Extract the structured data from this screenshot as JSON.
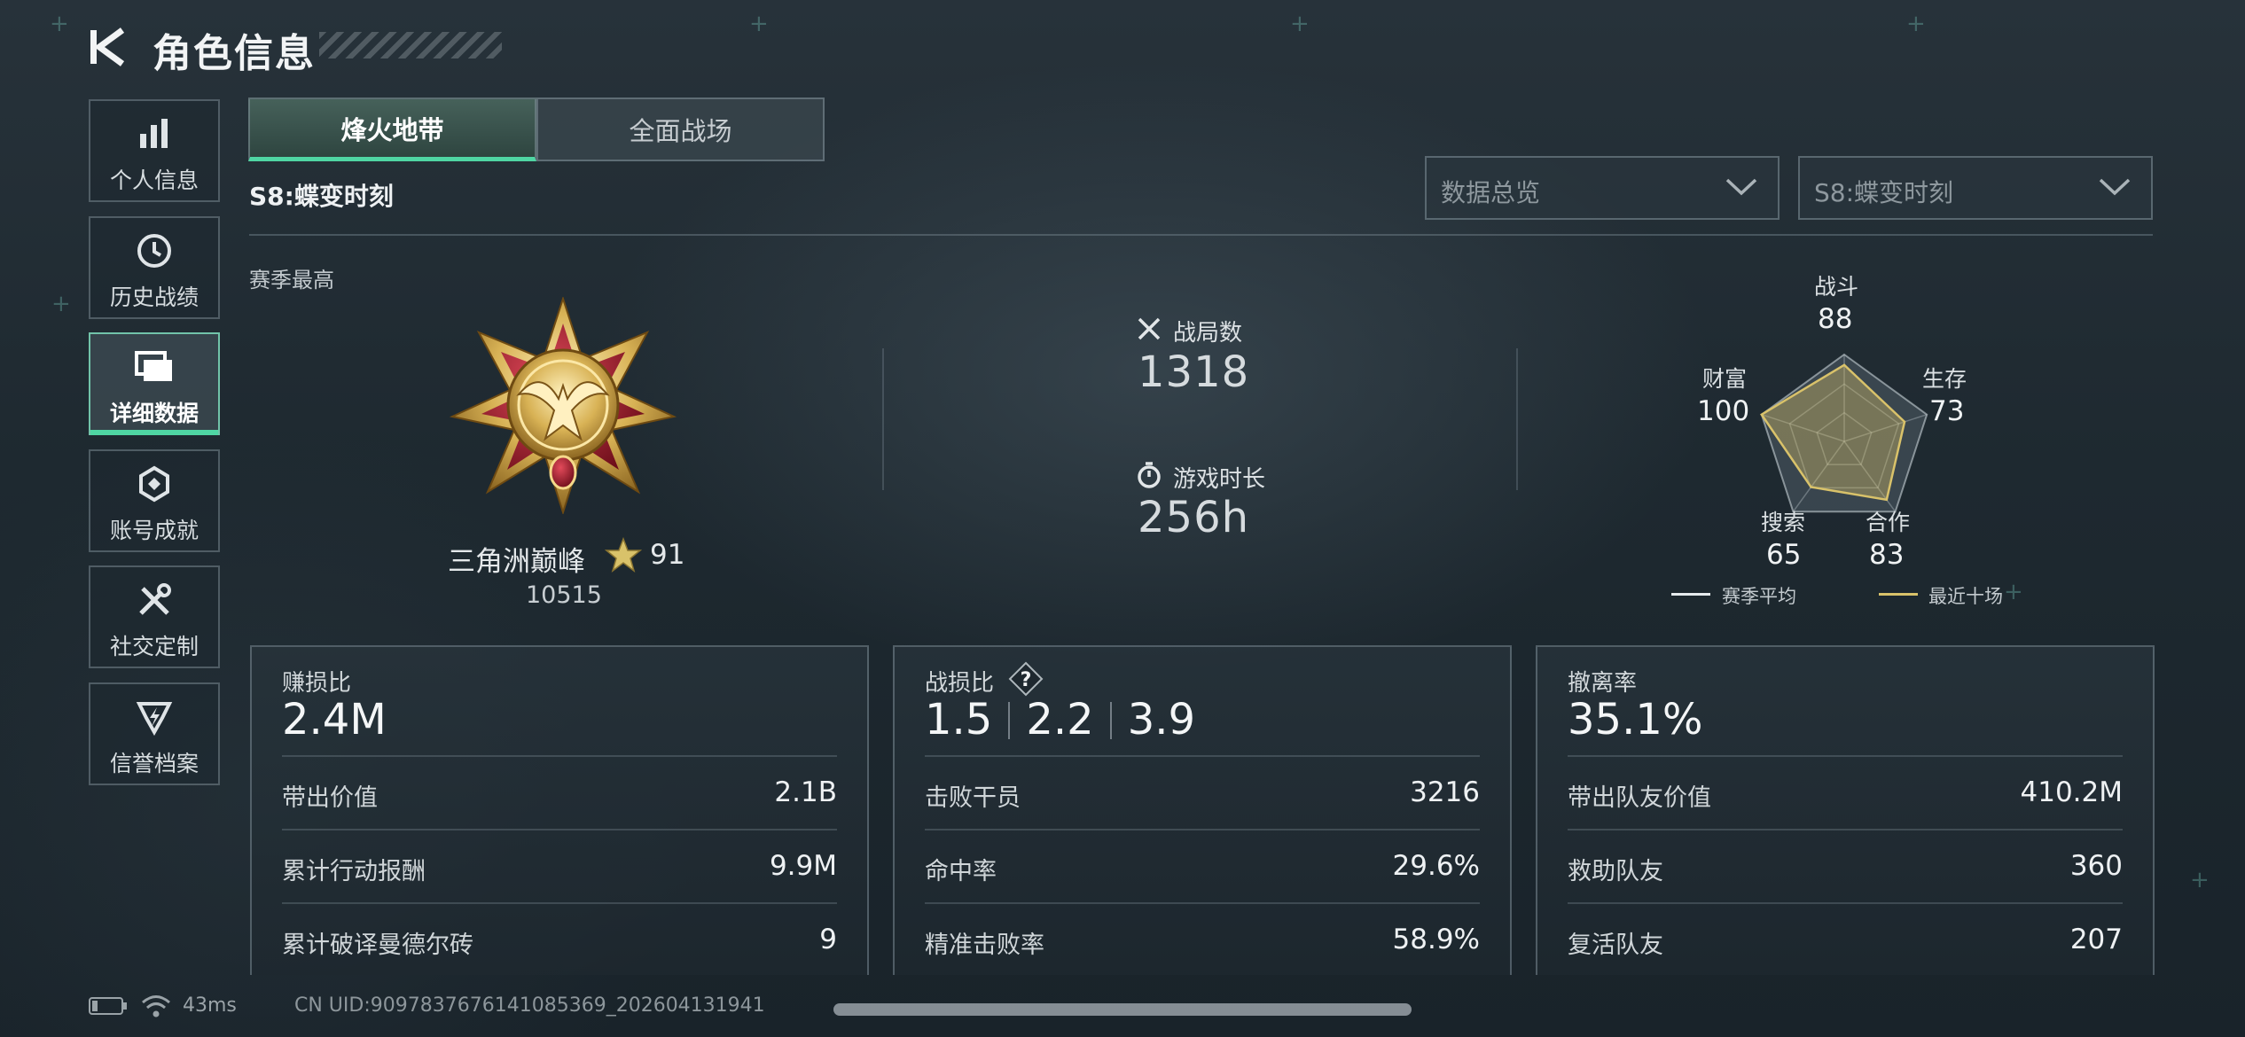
{
  "header": {
    "title": "角色信息"
  },
  "nav": {
    "items": [
      {
        "label": "个人信息",
        "icon": "bar-chart-icon"
      },
      {
        "label": "历史战绩",
        "icon": "clock-history-icon"
      },
      {
        "label": "详细数据",
        "icon": "cards-icon",
        "active": true
      },
      {
        "label": "账号成就",
        "icon": "achievement-icon"
      },
      {
        "label": "社交定制",
        "icon": "tools-icon"
      },
      {
        "label": "信誉档案",
        "icon": "shield-badge-icon"
      }
    ]
  },
  "tabs": [
    {
      "label": "烽火地带",
      "active": true
    },
    {
      "label": "全面战场",
      "active": false
    }
  ],
  "season": {
    "label": "S8:蝶变时刻"
  },
  "filters": {
    "data_type": "数据总览",
    "season": "S8:蝶变时刻"
  },
  "overview": {
    "season_best_label": "赛季最高",
    "rank_name": "三角洲巅峰",
    "rank_level": "91",
    "rank_score": "10515",
    "matches_label": "战局数",
    "matches_value": "1318",
    "playtime_label": "游戏时长",
    "playtime_value": "256h"
  },
  "radar": {
    "axes": [
      {
        "label": "战斗",
        "value": "88"
      },
      {
        "label": "生存",
        "value": "73"
      },
      {
        "label": "合作",
        "value": "83"
      },
      {
        "label": "搜索",
        "value": "65"
      },
      {
        "label": "财富",
        "value": "100"
      }
    ],
    "legend": {
      "season_avg": "赛季平均",
      "recent_ten": "最近十场"
    },
    "colors": {
      "season_avg": "#e6ebee",
      "recent_ten": "#d9c26a"
    }
  },
  "cards": {
    "profit": {
      "title": "赚损比",
      "big": "2.4M",
      "rows": [
        {
          "k": "带出价值",
          "v": "2.1B"
        },
        {
          "k": "累计行动报酬",
          "v": "9.9M"
        },
        {
          "k": "累计破译曼德尔砖",
          "v": "9"
        }
      ]
    },
    "kd": {
      "title": "战损比",
      "help": "?",
      "big": [
        "1.5",
        "2.2",
        "3.9"
      ],
      "rows": [
        {
          "k": "击败干员",
          "v": "3216"
        },
        {
          "k": "命中率",
          "v": "29.6%"
        },
        {
          "k": "精准击败率",
          "v": "58.9%"
        }
      ]
    },
    "extract": {
      "title": "撤离率",
      "big": "35.1%",
      "rows": [
        {
          "k": "带出队友价值",
          "v": "410.2M"
        },
        {
          "k": "救助队友",
          "v": "360"
        },
        {
          "k": "复活队友",
          "v": "207"
        }
      ]
    }
  },
  "footer": {
    "ping": "43ms",
    "uid": "CN UID:9097837676141085369_202604131941"
  },
  "colors": {
    "accent": "#4fd6a3",
    "gold": "#d9c26a"
  }
}
